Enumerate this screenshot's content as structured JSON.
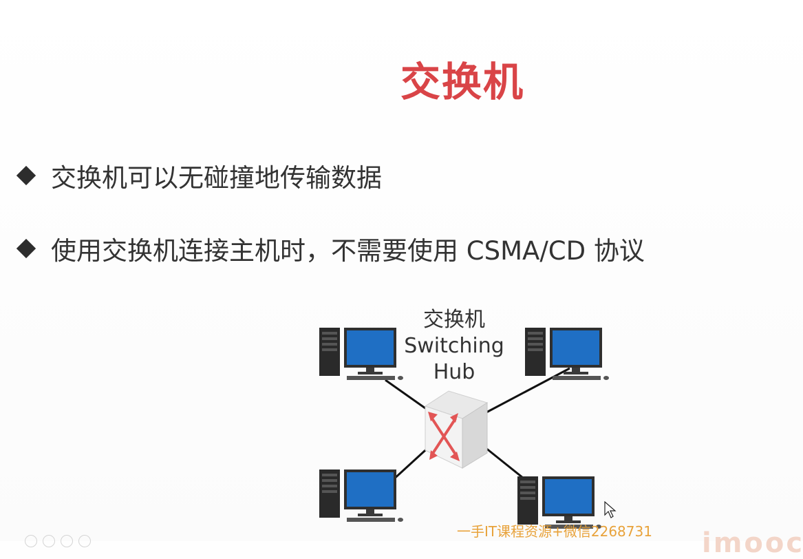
{
  "slide": {
    "title": "交换机",
    "bullets": [
      "交换机可以无碰撞地传输数据",
      "使用交换机连接主机时，不需要使用 CSMA/CD 协议"
    ]
  },
  "diagram": {
    "switch_label": [
      "交换机",
      "Switching",
      "Hub"
    ]
  },
  "watermark": {
    "text": "一手IT课程资源+微信2268731",
    "brand": "imooc"
  },
  "colors": {
    "title": "#d94447",
    "monitor_screen": "#1f6fc4",
    "watermark": "#e8a23a"
  }
}
